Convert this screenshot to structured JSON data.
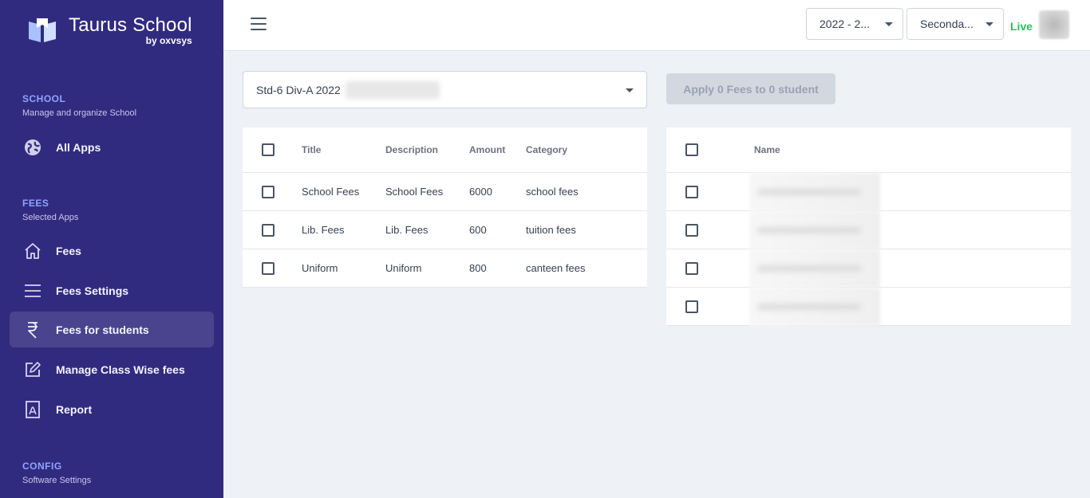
{
  "brand": {
    "title": "Taurus School",
    "subtitle": "by oxvsys"
  },
  "sidebar": {
    "sections": [
      {
        "title": "SCHOOL",
        "subtitle": "Manage and organize School"
      },
      {
        "title": "FEES",
        "subtitle": "Selected Apps"
      },
      {
        "title": "CONFIG",
        "subtitle": "Software Settings"
      }
    ],
    "items": [
      {
        "label": "All Apps",
        "icon": "globe-icon"
      },
      {
        "label": "Fees",
        "icon": "home-icon"
      },
      {
        "label": "Fees Settings",
        "icon": "menu-lines-icon"
      },
      {
        "label": "Fees for students",
        "icon": "rupee-icon",
        "active": true
      },
      {
        "label": "Manage Class Wise fees",
        "icon": "edit-icon"
      },
      {
        "label": "Report",
        "icon": "report-icon"
      }
    ]
  },
  "topbar": {
    "year_select": "2022 - 2...",
    "level_select": "Seconda...",
    "status": "Live"
  },
  "class_select": {
    "value": "Std-6 Div-A 2022"
  },
  "apply_button": "Apply 0 Fees to 0 student",
  "fees_table": {
    "headers": [
      "Title",
      "Description",
      "Amount",
      "Category"
    ],
    "rows": [
      [
        "School Fees",
        "School Fees",
        "6000",
        "school fees"
      ],
      [
        "Lib. Fees",
        "Lib. Fees",
        "600",
        "tuition fees"
      ],
      [
        "Uniform",
        "Uniform",
        "800",
        "canteen fees"
      ]
    ]
  },
  "students_table": {
    "headers": [
      "Name"
    ]
  },
  "colors": {
    "sidebar_bg": "#312b80",
    "accent": "#8fa4ff",
    "live": "#22c55e"
  }
}
